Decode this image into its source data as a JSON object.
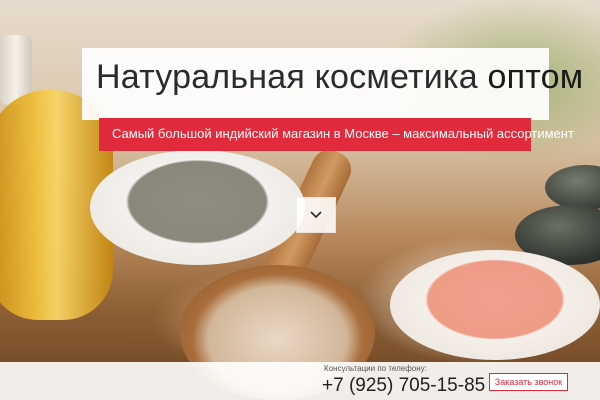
{
  "hero": {
    "title_regular": "Натуральная косметика",
    "title_bold": "оптом",
    "subtitle": "Самый большой индийский магазин в Москве – максимальный ассортимент",
    "scroll_icon": "chevron-down-icon"
  },
  "footer": {
    "consult_label": "Консультации по телефону:",
    "phone": "+7 (925) 705-15-85",
    "callback_button": "Заказать звонок"
  },
  "colors": {
    "accent": "#e12a3c",
    "text_dark": "#2b2b2b"
  }
}
